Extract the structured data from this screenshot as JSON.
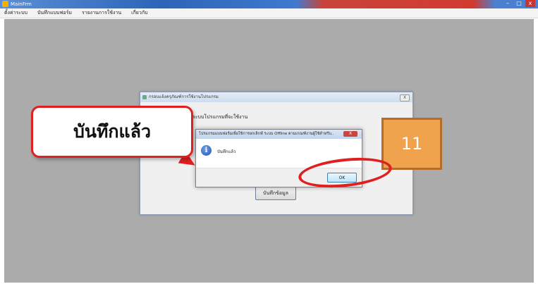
{
  "window": {
    "title": "MainFrm",
    "minimize": "–",
    "maximize": "□",
    "close": "x"
  },
  "menu": {
    "items": [
      "ตั้งค่าระบบ",
      "บันทึกแบบฟอร์ม",
      "รายงานการใช้งาน",
      "เกี่ยวกับ"
    ]
  },
  "form": {
    "title": "กรอบแจ้งครุภัณฑ์การใช้งานโปรแกรม",
    "heading": "ระบบโปรแกรมที่จะใช้งาน",
    "close_label": "X",
    "save_button": "บันทึกข้อมูล"
  },
  "msgbox": {
    "title": "โปรแกรมแบบฟอร์มเพื่อใช้การยกเลิกฟ์ ระบบ Offline ตามเกณฑ์งานผู้ใช้สำหรับ..",
    "message": "บันทึกแล้ว",
    "ok": "OK",
    "close_label": "X"
  },
  "annotation": {
    "callout_text": "บันทึกแล้ว",
    "step_number": "11",
    "callout_border_color": "#e02020",
    "step_color": "#f0a24c"
  }
}
